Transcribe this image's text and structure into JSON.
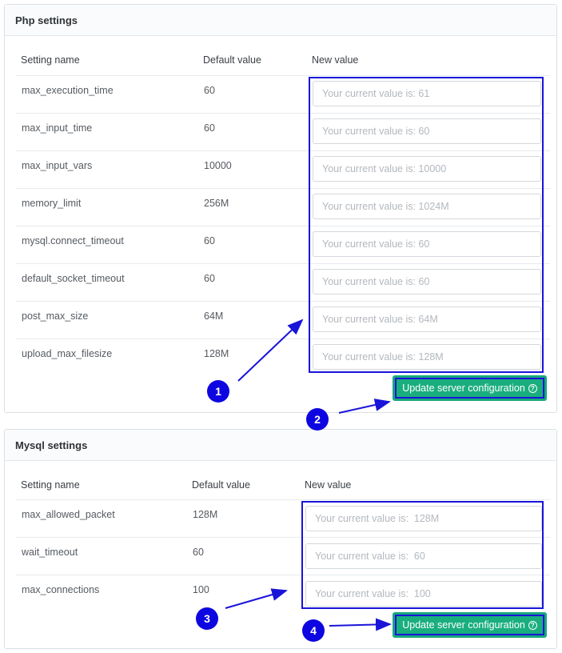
{
  "php": {
    "title": "Php settings",
    "headers": {
      "name": "Setting name",
      "default": "Default value",
      "new": "New value"
    },
    "rows": [
      {
        "name": "max_execution_time",
        "default": "60",
        "placeholder": "Your current value is: 61"
      },
      {
        "name": "max_input_time",
        "default": "60",
        "placeholder": "Your current value is: 60"
      },
      {
        "name": "max_input_vars",
        "default": "10000",
        "placeholder": "Your current value is: 10000"
      },
      {
        "name": "memory_limit",
        "default": "256M",
        "placeholder": "Your current value is: 1024M"
      },
      {
        "name": "mysql.connect_timeout",
        "default": "60",
        "placeholder": "Your current value is: 60"
      },
      {
        "name": "default_socket_timeout",
        "default": "60",
        "placeholder": "Your current value is: 60"
      },
      {
        "name": "post_max_size",
        "default": "64M",
        "placeholder": "Your current value is: 64M"
      },
      {
        "name": "upload_max_filesize",
        "default": "128M",
        "placeholder": "Your current value is: 128M"
      }
    ],
    "button_label": "Update server configuration",
    "button_icon": "question-circle-icon"
  },
  "mysql": {
    "title": "Mysql settings",
    "headers": {
      "name": "Setting name",
      "default": "Default value",
      "new": "New value"
    },
    "rows": [
      {
        "name": "max_allowed_packet",
        "default": "128M",
        "placeholder": "Your current value is:  128M"
      },
      {
        "name": "wait_timeout",
        "default": "60",
        "placeholder": "Your current value is:  60"
      },
      {
        "name": "max_connections",
        "default": "100",
        "placeholder": "Your current value is:  100"
      }
    ],
    "button_label": "Update server configuration",
    "button_icon": "question-circle-icon"
  },
  "annotations": {
    "badges": [
      "1",
      "2",
      "3",
      "4"
    ],
    "highlight_color": "#1a14d9",
    "badge_color": "#0d06e0",
    "button_color": "#1aae7e"
  }
}
